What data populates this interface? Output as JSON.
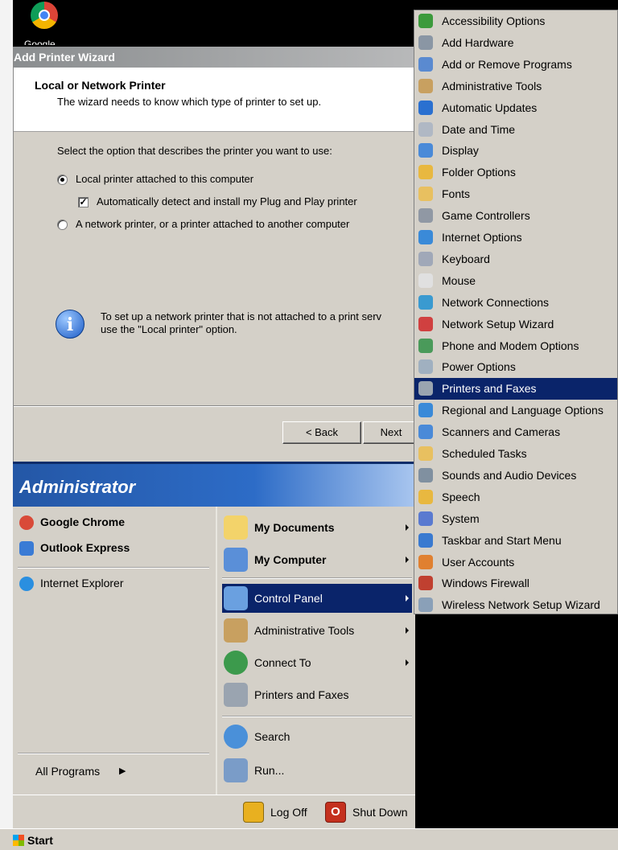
{
  "desktop": {
    "shortcut_label": "Google"
  },
  "wizard": {
    "title": "Add Printer Wizard",
    "heading": "Local or Network Printer",
    "subheading": "The wizard needs to know which type of printer to set up.",
    "prompt": "Select the option that describes the printer you want to use:",
    "option_local": "Local printer attached to this computer",
    "option_autodetect": "Automatically detect and install my Plug and Play printer",
    "option_network": "A network printer, or a printer attached to another computer",
    "info_text": "To set up a network printer that is not attached to a print serv\nuse the \"Local printer\" option.",
    "back_label": "< Back",
    "next_label": "Next"
  },
  "start_menu": {
    "user": "Administrator",
    "pinned": [
      {
        "label": "Google Chrome",
        "icon": "chrome-icon",
        "color": "#d94a38"
      },
      {
        "label": "Outlook Express",
        "icon": "outlook-express-icon",
        "color": "#3a7bd5"
      }
    ],
    "recent": [
      {
        "label": "Internet Explorer",
        "icon": "internet-explorer-icon",
        "color": "#2a8fe0"
      }
    ],
    "all_programs": "All Programs",
    "right_items": [
      {
        "label": "My Documents",
        "icon": "my-documents-icon",
        "color": "#f3d36a"
      },
      {
        "label": "My Computer",
        "icon": "my-computer-icon",
        "color": "#5a8fd8"
      },
      {
        "label": "Control Panel",
        "icon": "control-panel-icon",
        "color": "#6aa0e0"
      },
      {
        "label": "Administrative Tools",
        "icon": "administrative-tools-icon",
        "color": "#c8a060"
      },
      {
        "label": "Connect To",
        "icon": "connect-to-icon",
        "color": "#3c9a4c"
      },
      {
        "label": "Printers and Faxes",
        "icon": "printers-faxes-icon",
        "color": "#9aa4b0"
      },
      {
        "label": "Search",
        "icon": "search-icon",
        "color": "#4a90d9"
      },
      {
        "label": "Run...",
        "icon": "run-icon",
        "color": "#7a9cc8"
      }
    ],
    "log_off": "Log Off",
    "shut_down": "Shut Down"
  },
  "control_panel": {
    "selected": "Printers and Faxes",
    "items": [
      {
        "label": "Accessibility Options",
        "icon": "accessibility-icon",
        "color": "#3c9a3c"
      },
      {
        "label": "Add Hardware",
        "icon": "add-hardware-icon",
        "color": "#8a96a4"
      },
      {
        "label": "Add or Remove Programs",
        "icon": "add-remove-programs-icon",
        "color": "#5a8ad0"
      },
      {
        "label": "Administrative Tools",
        "icon": "administrative-tools-icon",
        "color": "#c8a060"
      },
      {
        "label": "Automatic Updates",
        "icon": "automatic-updates-icon",
        "color": "#2a70d0"
      },
      {
        "label": "Date and Time",
        "icon": "date-time-icon",
        "color": "#b0b8c4"
      },
      {
        "label": "Display",
        "icon": "display-icon",
        "color": "#4a8ad8"
      },
      {
        "label": "Folder Options",
        "icon": "folder-options-icon",
        "color": "#e8b840"
      },
      {
        "label": "Fonts",
        "icon": "fonts-icon",
        "color": "#e8c060"
      },
      {
        "label": "Game Controllers",
        "icon": "game-controllers-icon",
        "color": "#9098a4"
      },
      {
        "label": "Internet Options",
        "icon": "internet-options-icon",
        "color": "#3a8ad8"
      },
      {
        "label": "Keyboard",
        "icon": "keyboard-icon",
        "color": "#a0a8b8"
      },
      {
        "label": "Mouse",
        "icon": "mouse-icon",
        "color": "#e0e0e0"
      },
      {
        "label": "Network Connections",
        "icon": "network-connections-icon",
        "color": "#3a9ad0"
      },
      {
        "label": "Network Setup Wizard",
        "icon": "network-setup-wizard-icon",
        "color": "#d04040"
      },
      {
        "label": "Phone and Modem Options",
        "icon": "phone-modem-icon",
        "color": "#4a9a5a"
      },
      {
        "label": "Power Options",
        "icon": "power-options-icon",
        "color": "#a0b0c0"
      },
      {
        "label": "Printers and Faxes",
        "icon": "printers-faxes-icon",
        "color": "#9aa4b0"
      },
      {
        "label": "Regional and Language Options",
        "icon": "regional-language-icon",
        "color": "#3a8ad8"
      },
      {
        "label": "Scanners and Cameras",
        "icon": "scanners-cameras-icon",
        "color": "#4a8ad8"
      },
      {
        "label": "Scheduled Tasks",
        "icon": "scheduled-tasks-icon",
        "color": "#e8c060"
      },
      {
        "label": "Sounds and Audio Devices",
        "icon": "sounds-audio-icon",
        "color": "#8090a0"
      },
      {
        "label": "Speech",
        "icon": "speech-icon",
        "color": "#e8b840"
      },
      {
        "label": "System",
        "icon": "system-icon",
        "color": "#5a7ad0"
      },
      {
        "label": "Taskbar and Start Menu",
        "icon": "taskbar-start-menu-icon",
        "color": "#3a7ad0"
      },
      {
        "label": "User Accounts",
        "icon": "user-accounts-icon",
        "color": "#e08030"
      },
      {
        "label": "Windows Firewall",
        "icon": "windows-firewall-icon",
        "color": "#c04030"
      },
      {
        "label": "Wireless Network Setup Wizard",
        "icon": "wireless-network-icon",
        "color": "#8aa0b8"
      }
    ]
  },
  "taskbar": {
    "start_label": "Start"
  }
}
